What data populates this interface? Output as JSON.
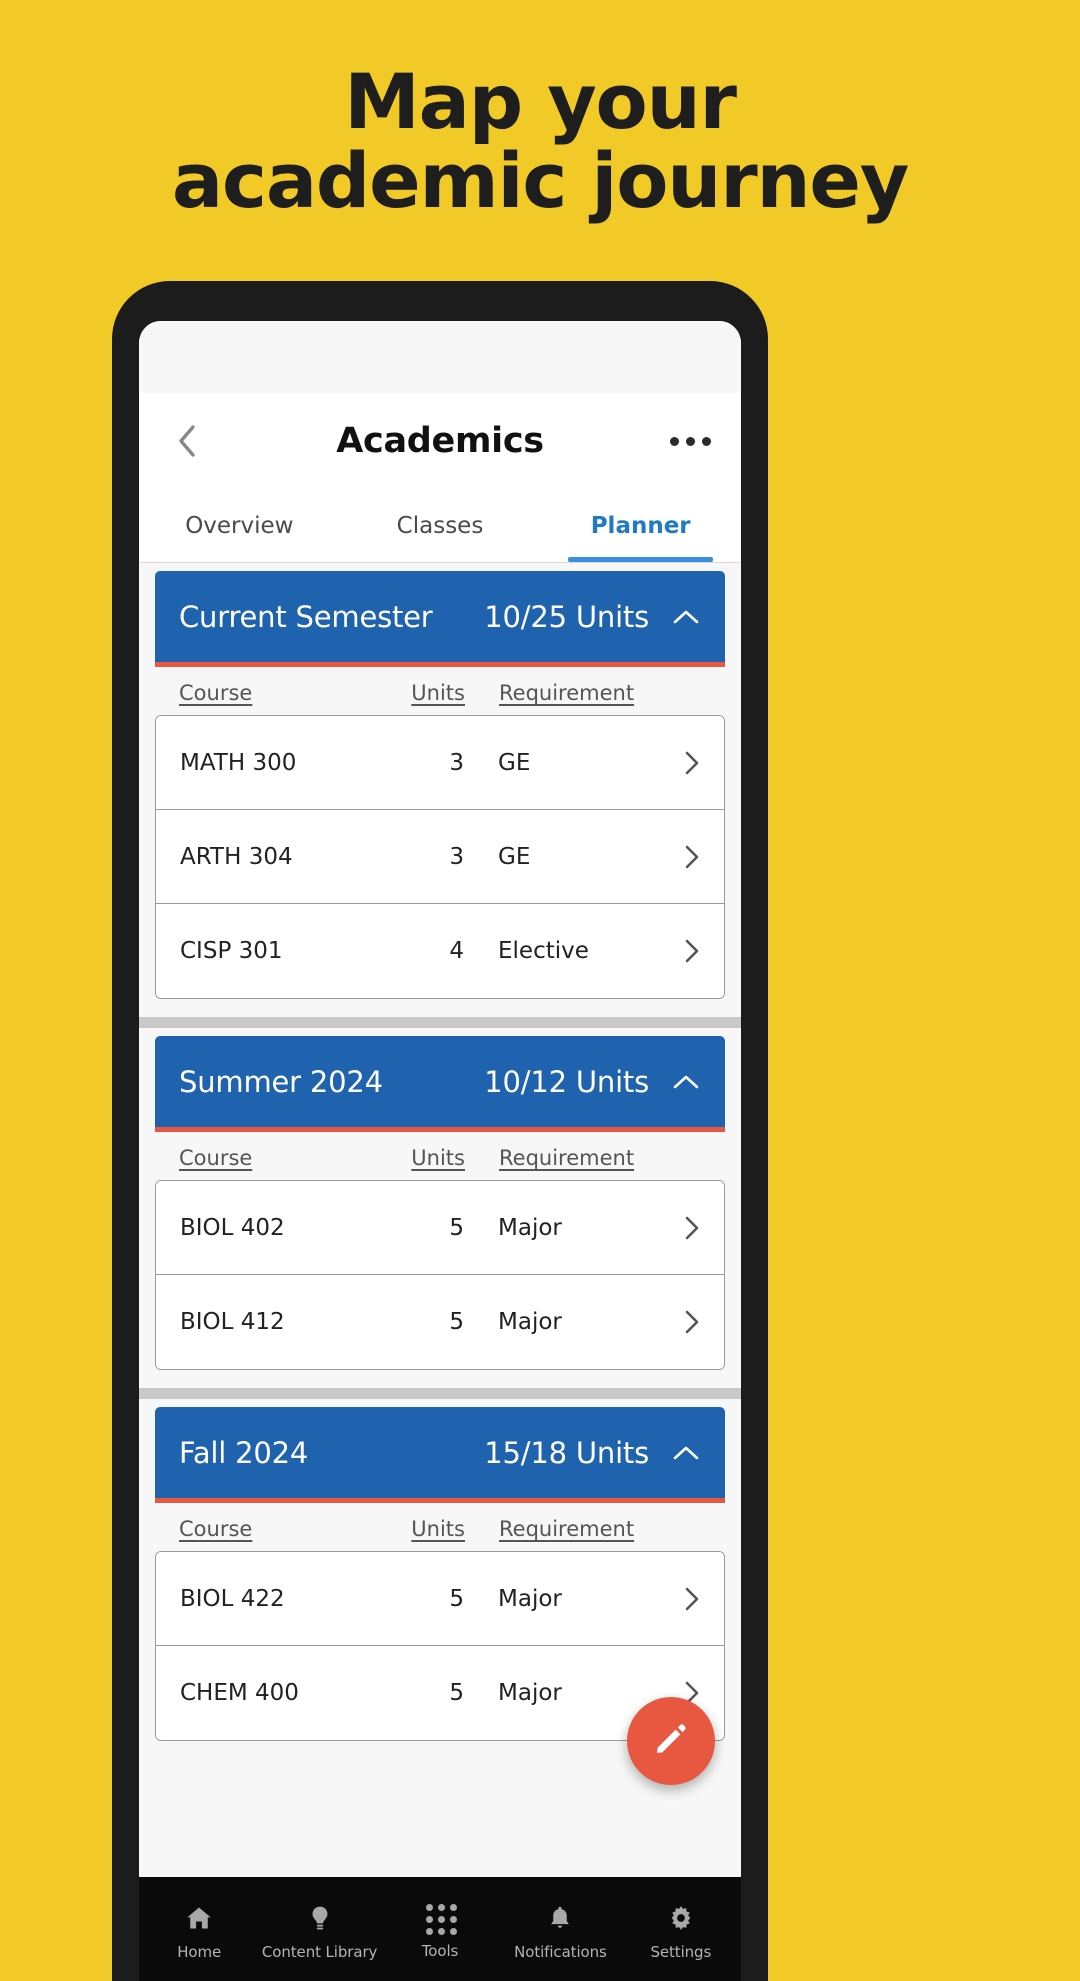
{
  "promo": {
    "headline_line1": "Map your",
    "headline_line2": "academic journey",
    "background_color": "#F2CA27"
  },
  "app": {
    "header": {
      "back_icon": "chevron-left-icon",
      "title": "Academics",
      "overflow_icon": "more-horizontal-icon"
    },
    "tabs": [
      {
        "label": "Overview",
        "active": false
      },
      {
        "label": "Classes",
        "active": false
      },
      {
        "label": "Planner",
        "active": true
      }
    ],
    "accent_colors": {
      "header_blue": "#1F63AF",
      "underline_red": "#E8573F",
      "tab_active_blue": "#2279C4",
      "fab_red": "#E8573F"
    },
    "table_columns": {
      "course": "Course",
      "units": "Units",
      "requirement": "Requirement"
    },
    "semesters": [
      {
        "title": "Current Semester",
        "units": "10/25 Units",
        "collapse_icon": "chevron-up-icon",
        "courses": [
          {
            "name": "MATH 300",
            "units": "3",
            "requirement": "GE"
          },
          {
            "name": "ARTH 304",
            "units": "3",
            "requirement": "GE"
          },
          {
            "name": "CISP 301",
            "units": "4",
            "requirement": "Elective"
          }
        ]
      },
      {
        "title": "Summer 2024",
        "units": "10/12 Units",
        "collapse_icon": "chevron-up-icon",
        "courses": [
          {
            "name": "BIOL 402",
            "units": "5",
            "requirement": "Major"
          },
          {
            "name": "BIOL 412",
            "units": "5",
            "requirement": "Major"
          }
        ]
      },
      {
        "title": "Fall 2024",
        "units": "15/18 Units",
        "collapse_icon": "chevron-up-icon",
        "courses": [
          {
            "name": "BIOL 422",
            "units": "5",
            "requirement": "Major"
          },
          {
            "name": "CHEM 400",
            "units": "5",
            "requirement": "Major"
          }
        ]
      }
    ],
    "fab": {
      "icon": "pencil-icon",
      "label": "Edit"
    },
    "bottom_nav": [
      {
        "label": "Home",
        "icon": "home-icon"
      },
      {
        "label": "Content Library",
        "icon": "lightbulb-icon"
      },
      {
        "label": "Tools",
        "icon": "grid-dots-icon"
      },
      {
        "label": "Notifications",
        "icon": "bell-icon"
      },
      {
        "label": "Settings",
        "icon": "gear-icon"
      }
    ]
  }
}
